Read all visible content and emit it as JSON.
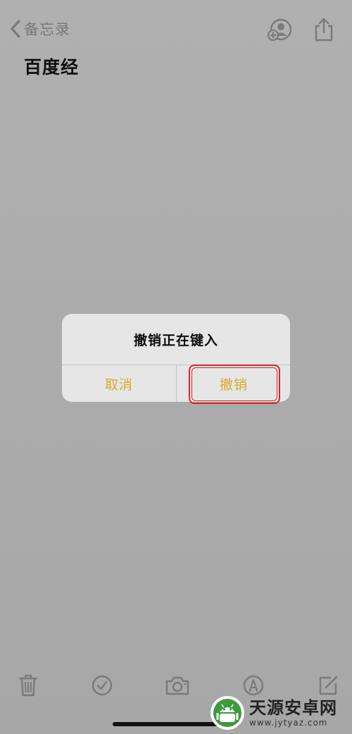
{
  "nav": {
    "back_label": "备忘录",
    "add_people_icon": "add-person-icon",
    "share_icon": "share-icon"
  },
  "note": {
    "title": "百度经"
  },
  "alert": {
    "title": "撤销正在键入",
    "cancel_label": "取消",
    "confirm_label": "撤销",
    "button_color": "#d9a92b",
    "highlight_color": "#d2272b"
  },
  "toolbar": {
    "icons": [
      "trash-icon",
      "checklist-icon",
      "camera-icon",
      "markup-icon",
      "compose-icon"
    ]
  },
  "watermark": {
    "title": "天源安卓网",
    "url": "www.jytyaz.com"
  }
}
